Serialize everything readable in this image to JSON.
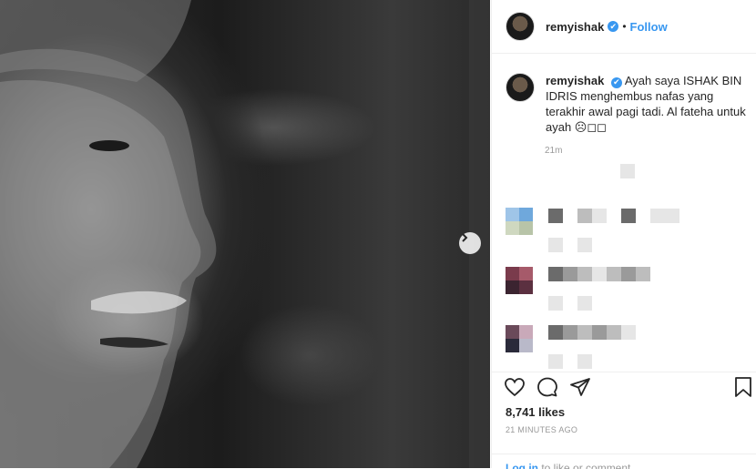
{
  "post": {
    "username": "remyishak",
    "verified_badge": "✔",
    "separator": "•",
    "follow_label": "Follow",
    "caption_username": "remyishak",
    "caption_text": "Ayah saya ISHAK BIN IDRIS menghembus nafas yang terakhir awal pagi tadi. Al fateha untuk ayah ☹◻◻",
    "caption_time": "21m",
    "likes": "8,741 likes",
    "posted_ago": "21 MINUTES AGO",
    "login_label": "Log in",
    "login_suffix": " to like or comment."
  },
  "icons": {
    "next": "chevron-right-icon",
    "like": "heart-icon",
    "comment": "comment-icon",
    "share": "paper-plane-icon",
    "save": "bookmark-icon",
    "verified": "verified-badge-icon"
  },
  "colors": {
    "accent": "#3897f0",
    "text": "#262626",
    "muted": "#999999",
    "border": "#efefef"
  }
}
